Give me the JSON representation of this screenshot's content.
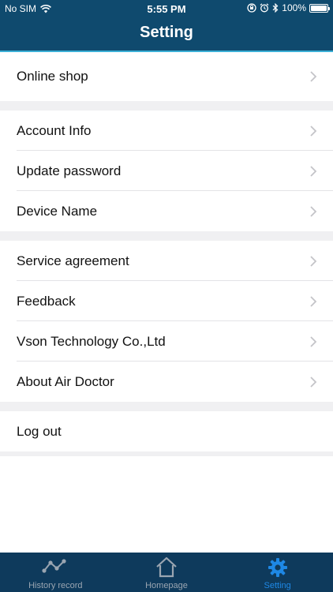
{
  "status_bar": {
    "carrier": "No SIM",
    "time": "5:55 PM",
    "battery": "100%"
  },
  "nav": {
    "title": "Setting"
  },
  "groups": [
    {
      "items": [
        {
          "label": "Online shop"
        }
      ]
    },
    {
      "items": [
        {
          "label": "Account Info"
        },
        {
          "label": "Update password"
        },
        {
          "label": "Device Name"
        }
      ]
    },
    {
      "items": [
        {
          "label": "Service agreement"
        },
        {
          "label": "Feedback"
        },
        {
          "label": "Vson Technology Co.,Ltd"
        },
        {
          "label": "About Air Doctor"
        }
      ]
    },
    {
      "items": [
        {
          "label": "Log out"
        }
      ]
    }
  ],
  "tabbar": {
    "tabs": [
      {
        "label": "History record",
        "icon": "line-chart-icon",
        "active": false
      },
      {
        "label": "Homepage",
        "icon": "home-icon",
        "active": false
      },
      {
        "label": "Setting",
        "icon": "gear-icon",
        "active": true
      }
    ]
  },
  "colors": {
    "header_bg": "#0f4a6e",
    "tabbar_bg": "#0e3a5c",
    "active_tab": "#1e88e5",
    "inactive_tab": "#9aa5b1"
  }
}
